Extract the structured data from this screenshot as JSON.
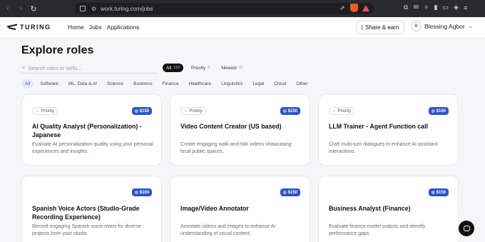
{
  "browser": {
    "url": "work.turing.com/jobs"
  },
  "header": {
    "logo_text": "TURING",
    "nav": [
      "Home",
      "Jobs",
      "Applications"
    ],
    "share_label": "Share & earn",
    "user_initial": "B",
    "user_name": "Blessing Agbor"
  },
  "page": {
    "title": "Explore roles",
    "search_placeholder": "Search roles or skills...",
    "tabs": [
      {
        "label": "All",
        "count": "118"
      },
      {
        "label": "Priority",
        "count": "3"
      },
      {
        "label": "Newest",
        "count": "27"
      }
    ],
    "categories": [
      "All",
      "Software",
      "ML, Data & AI",
      "Science",
      "Business",
      "Finance",
      "Healthcare",
      "Linguistics",
      "Legal",
      "Cloud",
      "Other"
    ]
  },
  "cards": [
    {
      "priority": "Priority",
      "pay": "$150",
      "title": "AI Quality Analyst (Personalization) - Japanese",
      "desc": "Evaluate AI personalization quality using your personal experiences and insights."
    },
    {
      "priority": "Priority",
      "pay": "$150",
      "title": "Video Content Creator (US based)",
      "desc": "Create engaging walk-and-talk videos showcasing local public spaces."
    },
    {
      "priority": "Priority",
      "pay": "$150",
      "title": "LLM Trainer - Agent Function call",
      "desc": "Craft multi-turn dialogues to enhance AI assistant interactions."
    },
    {
      "priority": "",
      "pay": "$100",
      "title": "Spanish Voice Actors (Studio-Grade Recording Experience)",
      "desc": "Record engaging Spanish voice-overs for diverse projects from your studio."
    },
    {
      "priority": "",
      "pay": "$150",
      "title": "Image/Video Annotator",
      "desc": "Annotate videos and images to enhance AI understanding of visual content."
    },
    {
      "priority": "",
      "pay": "$150",
      "title": "Business Analyst (Finance)",
      "desc": "Evaluate finance model outputs and identify performance gaps."
    }
  ],
  "colors": {
    "accent": "#2e54c8",
    "category_active_bg": "#e4e8fb"
  },
  "icons": [
    "back-icon",
    "forward-icon",
    "reload-icon",
    "bookmark-icon",
    "site-settings-icon",
    "share-icon",
    "brave-shield-icon",
    "brave-rewards-icon",
    "extensions-icon",
    "search-icon",
    "star-icon",
    "coin-icon",
    "chevron-down-icon",
    "chat-icon"
  ]
}
